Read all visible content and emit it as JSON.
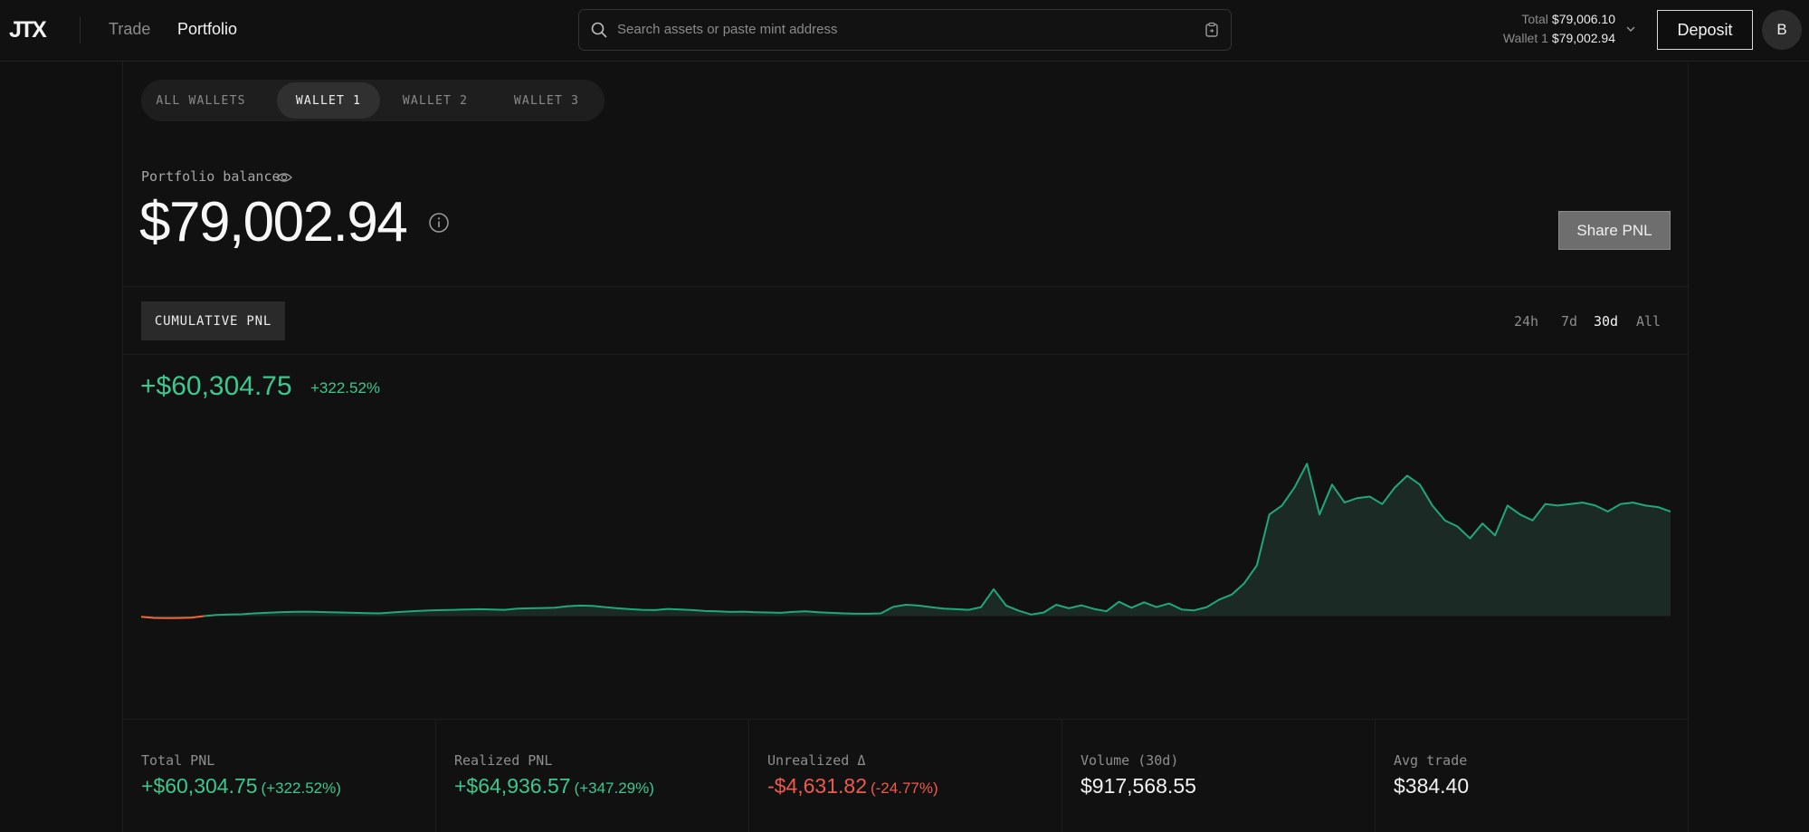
{
  "header": {
    "logo": "JTX",
    "nav": [
      "Trade",
      "Portfolio"
    ],
    "search_placeholder": "Search assets or paste mint address",
    "total_label": "Total",
    "total_value": "$79,006.10",
    "wallet_label": "Wallet 1",
    "wallet_value": "$79,002.94",
    "deposit_label": "Deposit",
    "avatar_initial": "B"
  },
  "wallet_tabs": [
    "ALL WALLETS",
    "WALLET 1",
    "WALLET 2",
    "WALLET 3"
  ],
  "active_wallet_tab": "WALLET 1",
  "portfolio": {
    "balance_label": "Portfolio balance",
    "balance_value": "$79,002.94",
    "share_label": "Share PNL"
  },
  "chart_section": {
    "tab_label": "CUMULATIVE PNL",
    "ranges": [
      "24h",
      "7d",
      "30d",
      "All"
    ],
    "active_range": "30d",
    "pnl_value": "+$60,304.75",
    "pnl_pct": "+322.52%"
  },
  "chart_data": {
    "type": "area",
    "title": "",
    "xlabel": "",
    "ylabel": "",
    "color": "#21a87a",
    "negative_color": "#ef6a3b",
    "series": [
      {
        "values": [
          -200,
          -600,
          -700,
          -650,
          -500,
          0,
          400,
          500,
          600,
          900,
          1100,
          1300,
          1400,
          1500,
          1400,
          1300,
          1200,
          1100,
          1000,
          900,
          1200,
          1500,
          1700,
          1900,
          2000,
          2100,
          2200,
          2300,
          2200,
          2100,
          2500,
          2600,
          2700,
          2800,
          3300,
          3500,
          3400,
          3000,
          2600,
          2300,
          2100,
          2000,
          2400,
          2200,
          2000,
          1700,
          1600,
          1400,
          1500,
          1300,
          1200,
          1100,
          1400,
          1600,
          1300,
          1100,
          900,
          800,
          800,
          900,
          3100,
          3800,
          3500,
          3000,
          2500,
          2300,
          2100,
          3000,
          9000,
          3500,
          1800,
          500,
          1200,
          3800,
          2600,
          3600,
          2400,
          1600,
          4800,
          2800,
          4600,
          3000,
          4200,
          2200,
          1900,
          3000,
          5500,
          7200,
          11000,
          17000,
          34000,
          37000,
          43000,
          51000,
          34000,
          44000,
          38000,
          39500,
          40000,
          37500,
          43000,
          47000,
          44000,
          37000,
          32000,
          30000,
          26000,
          31000,
          27000,
          37000,
          34000,
          32000,
          37500,
          37000,
          37500,
          38000,
          37000,
          35000,
          37500,
          38000,
          37000,
          36500,
          35000
        ]
      }
    ]
  },
  "stats": [
    {
      "label": "Total PNL",
      "value": "+$60,304.75",
      "sub": "(+322.52%)",
      "tone": "green"
    },
    {
      "label": "Realized PNL",
      "value": "+$64,936.57",
      "sub": "(+347.29%)",
      "tone": "green"
    },
    {
      "label": "Unrealized Δ",
      "value": "-$4,631.82",
      "sub": "(-24.77%)",
      "tone": "red"
    },
    {
      "label": "Volume (30d)",
      "value": "$917,568.55",
      "sub": "",
      "tone": "neutral"
    },
    {
      "label": "Avg trade",
      "value": "$384.40",
      "sub": "",
      "tone": "neutral"
    }
  ],
  "icons": {
    "search": "search-icon",
    "paste": "clipboard-icon",
    "chevron": "chevron-down-icon",
    "eye": "eye-icon",
    "info": "info-icon"
  }
}
